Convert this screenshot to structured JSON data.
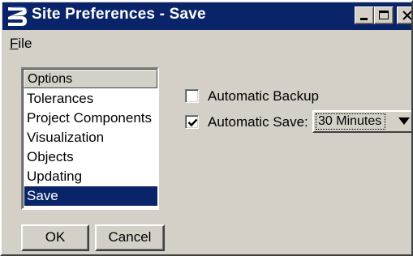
{
  "window": {
    "title": "Site Preferences - Save",
    "app_icon": "bentley-b-icon"
  },
  "menubar": {
    "file": "File"
  },
  "options": {
    "header": "Options",
    "items": [
      {
        "label": "Tolerances",
        "selected": false
      },
      {
        "label": "Project Components",
        "selected": false
      },
      {
        "label": "Visualization",
        "selected": false
      },
      {
        "label": "Objects",
        "selected": false
      },
      {
        "label": "Updating",
        "selected": false
      },
      {
        "label": "Save",
        "selected": true
      }
    ]
  },
  "settings": {
    "automatic_backup": {
      "label": "Automatic Backup",
      "checked": false
    },
    "automatic_save": {
      "label": "Automatic Save:",
      "checked": true
    },
    "save_interval": {
      "value": "30 Minutes"
    }
  },
  "buttons": {
    "ok": "OK",
    "cancel": "Cancel"
  },
  "colors": {
    "titlebar": "#0a246a",
    "selection": "#0a246a",
    "face": "#d4d0c8"
  }
}
